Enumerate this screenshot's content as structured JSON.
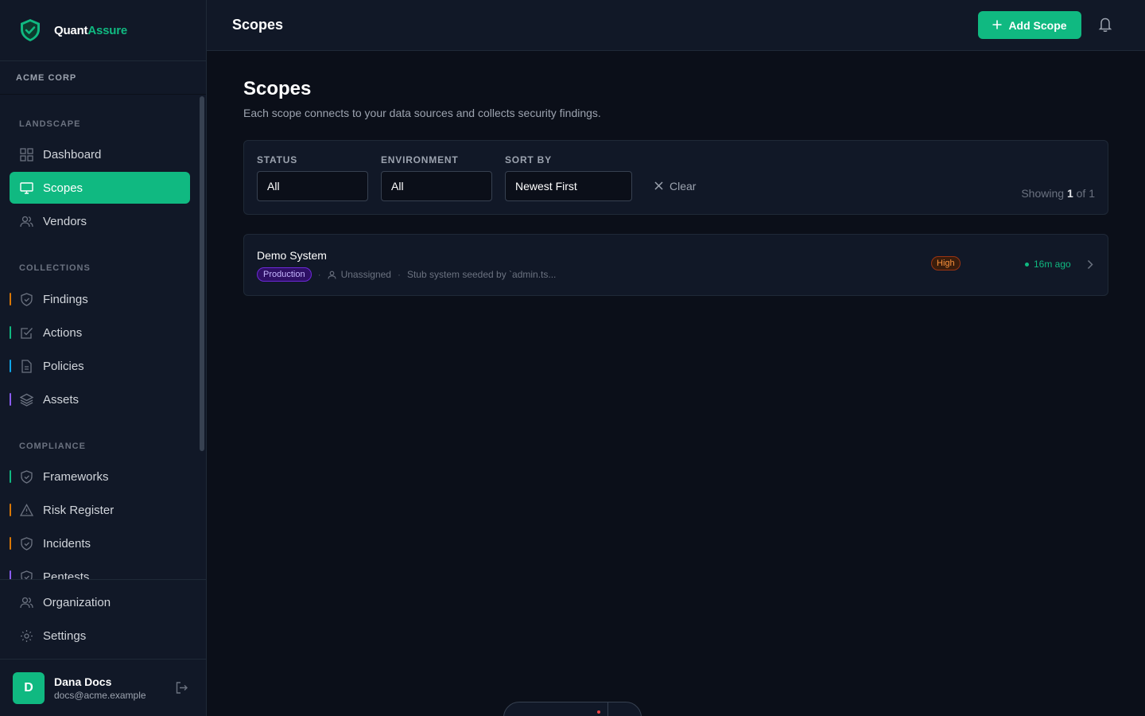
{
  "brand": {
    "name_part1": "Quant",
    "name_part2": "Assure"
  },
  "org": {
    "name": "ACME CORP"
  },
  "sidebar": {
    "sections": [
      {
        "label": "LANDSCAPE"
      },
      {
        "label": "COLLECTIONS"
      },
      {
        "label": "COMPLIANCE"
      }
    ],
    "items": [
      {
        "label": "Dashboard",
        "icon": "grid-icon"
      },
      {
        "label": "Scopes",
        "icon": "monitor-icon",
        "active": true
      },
      {
        "label": "Vendors",
        "icon": "users-icon"
      },
      {
        "label": "Findings",
        "icon": "shield-icon",
        "accent": "#d97706"
      },
      {
        "label": "Actions",
        "icon": "checkbox-icon",
        "accent": "#10b981"
      },
      {
        "label": "Policies",
        "icon": "document-icon",
        "accent": "#0ea5e9"
      },
      {
        "label": "Assets",
        "icon": "layers-icon",
        "accent": "#8b5cf6"
      },
      {
        "label": "Frameworks",
        "icon": "shield-icon",
        "accent": "#10b981"
      },
      {
        "label": "Risk Register",
        "icon": "warning-icon",
        "accent": "#d97706"
      },
      {
        "label": "Incidents",
        "icon": "shield-icon",
        "accent": "#d97706"
      },
      {
        "label": "Pentests",
        "icon": "shield-icon",
        "accent": "#8b5cf6"
      }
    ],
    "bottom_items": [
      {
        "label": "Organization",
        "icon": "users-icon"
      },
      {
        "label": "Settings",
        "icon": "gear-icon"
      }
    ]
  },
  "user": {
    "initial": "D",
    "name": "Dana Docs",
    "email": "docs@acme.example"
  },
  "topbar": {
    "title": "Scopes",
    "add_label": "Add Scope"
  },
  "page": {
    "title": "Scopes",
    "subtitle": "Each scope connects to your data sources and collects security findings."
  },
  "filters": {
    "status_label": "STATUS",
    "status_value": "All",
    "env_label": "ENVIRONMENT",
    "env_value": "All",
    "sort_label": "SORT BY",
    "sort_value": "Newest First",
    "clear_label": "Clear",
    "showing_prefix": "Showing",
    "showing_count": "1",
    "showing_of": "of",
    "showing_total": "1"
  },
  "scopes": [
    {
      "name": "Demo System",
      "environment": "Production",
      "owner": "Unassigned",
      "description": "Stub system seeded by `admin.ts...",
      "risk": "High",
      "updated": "16m ago"
    }
  ],
  "colors": {
    "accent": "#10b981",
    "background": "#0b0f19",
    "panel": "#111827"
  }
}
